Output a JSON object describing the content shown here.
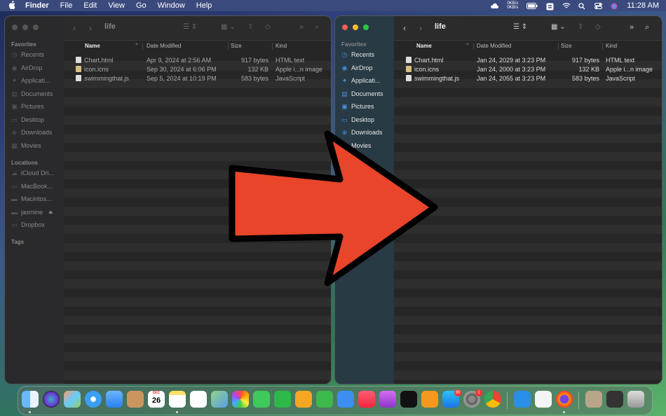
{
  "menubar": {
    "apple": "",
    "app": "Finder",
    "items": [
      "File",
      "Edit",
      "View",
      "Go",
      "Window",
      "Help"
    ],
    "net_up": "0KB/s",
    "net_down": "0KB/s",
    "clock": "11:28 AM",
    "icons": [
      "weather-icon",
      "network-icon",
      "battery-icon",
      "s-app-icon",
      "wifi-icon",
      "search-icon",
      "control-center-icon",
      "siri-icon"
    ]
  },
  "left": {
    "title": "life",
    "favorites_label": "Favorites",
    "favorites": [
      {
        "label": "Recents",
        "icon": "clock-icon"
      },
      {
        "label": "AirDrop",
        "icon": "airdrop-icon"
      },
      {
        "label": "Applicati...",
        "icon": "applications-icon"
      },
      {
        "label": "Documents",
        "icon": "documents-icon"
      },
      {
        "label": "Pictures",
        "icon": "pictures-icon"
      },
      {
        "label": "Desktop",
        "icon": "desktop-icon"
      },
      {
        "label": "Downloads",
        "icon": "downloads-icon"
      },
      {
        "label": "Movies",
        "icon": "movies-icon"
      }
    ],
    "locations_label": "Locations",
    "locations": [
      {
        "label": "iCloud Dri...",
        "icon": "icloud-icon"
      },
      {
        "label": "MacBook...",
        "icon": "laptop-icon"
      },
      {
        "label": "Macintos...",
        "icon": "disk-icon"
      },
      {
        "label": "jasmine",
        "icon": "disk-icon"
      },
      {
        "label": "Dropbox",
        "icon": "folder-icon"
      }
    ],
    "tags_label": "Tags",
    "columns": {
      "name": "Name",
      "date": "Date Modified",
      "size": "Size",
      "kind": "Kind"
    },
    "files": [
      {
        "name": "Chart.html",
        "date": "Apr 9, 2024 at 2:56 AM",
        "size": "917 bytes",
        "kind": "HTML text"
      },
      {
        "name": "icon.icns",
        "date": "Sep 30, 2024 at 6:06 PM",
        "size": "132 KB",
        "kind": "Apple i...n image"
      },
      {
        "name": "swimmingthat.js",
        "date": "Sep 5, 2024 at 10:19 PM",
        "size": "583 bytes",
        "kind": "JavaScript"
      }
    ]
  },
  "right": {
    "title": "life",
    "favorites_label": "Favorites",
    "favorites": [
      {
        "label": "Recents",
        "icon": "clock-icon"
      },
      {
        "label": "AirDrop",
        "icon": "airdrop-icon"
      },
      {
        "label": "Applicati...",
        "icon": "applications-icon"
      },
      {
        "label": "Documents",
        "icon": "documents-icon"
      },
      {
        "label": "Pictures",
        "icon": "pictures-icon"
      },
      {
        "label": "Desktop",
        "icon": "desktop-icon"
      },
      {
        "label": "Downloads",
        "icon": "downloads-icon"
      },
      {
        "label": "Movies",
        "icon": "movies-icon"
      }
    ],
    "columns": {
      "name": "Name",
      "date": "Date Modified",
      "size": "Size",
      "kind": "Kind"
    },
    "files": [
      {
        "name": "Chart.html",
        "date": "Jan 24, 2029 at 3:23 PM",
        "size": "917 bytes",
        "kind": "HTML text"
      },
      {
        "name": "icon.icns",
        "date": "Jan 24, 2000 at 3:23 PM",
        "size": "132 KB",
        "kind": "Apple i...n image"
      },
      {
        "name": "swimmingthat.js",
        "date": "Jan 24, 2055 at 3:23 PM",
        "size": "583 bytes",
        "kind": "JavaScript"
      }
    ]
  },
  "arrow": {
    "fill": "#e8452a",
    "outline": "#000000"
  },
  "dock": {
    "calendar_month": "DEC",
    "calendar_day": "26",
    "appstore_badge": "30",
    "settings_badge": "1",
    "apps": [
      "finder-icon",
      "siri-icon",
      "launchpad-icon",
      "safari-icon",
      "mail-icon",
      "contacts-icon",
      "calendar-icon",
      "notes-icon",
      "reminders-icon",
      "maps-icon",
      "photos-icon",
      "messages-icon",
      "facetime-icon",
      "pages-icon",
      "numbers-icon",
      "keynote-icon",
      "music-icon",
      "podcasts-icon",
      "tv-icon",
      "books-icon",
      "app-store-icon",
      "system-settings-icon",
      "chrome-icon",
      "separator",
      "vscode-icon",
      "textedit-icon",
      "firefox-icon",
      "separator",
      "archive-icon",
      "screen-icon",
      "trash-icon"
    ]
  }
}
